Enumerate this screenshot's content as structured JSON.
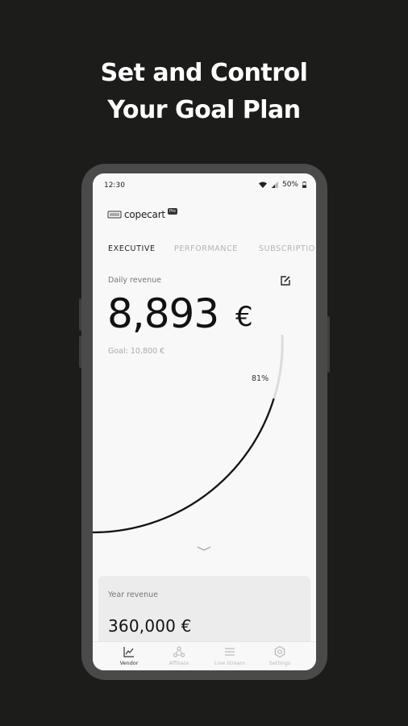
{
  "headline": {
    "line1": "Set and Control",
    "line2": "Your Goal Plan"
  },
  "statusbar": {
    "time": "12:30",
    "battery": "50%"
  },
  "app": {
    "logo_text": "copecart",
    "logo_badge": "Pro"
  },
  "tabs": [
    {
      "label": "EXECUTIVE",
      "active": true
    },
    {
      "label": "PERFORMANCE",
      "active": false
    },
    {
      "label": "SUBSCRIPTIO",
      "active": false
    }
  ],
  "daily": {
    "label": "Daily revenue",
    "value": "8,893",
    "currency": "€",
    "goal": "Goal: 10,800 €",
    "progress_pct": 81,
    "progress_label": "81%"
  },
  "year": {
    "label": "Year revenue",
    "value": "360,000 €"
  },
  "nav": [
    {
      "label": "Vendor",
      "icon": "chart-line-icon",
      "active": true
    },
    {
      "label": "Affiliate",
      "icon": "network-icon",
      "active": false
    },
    {
      "label": "Live stream",
      "icon": "list-icon",
      "active": false
    },
    {
      "label": "Settings",
      "icon": "gear-icon",
      "active": false
    }
  ],
  "colors": {
    "background": "#1c1d1b",
    "phone_frame": "#4a4a4a",
    "screen": "#f8f8f8",
    "text": "#111111"
  }
}
